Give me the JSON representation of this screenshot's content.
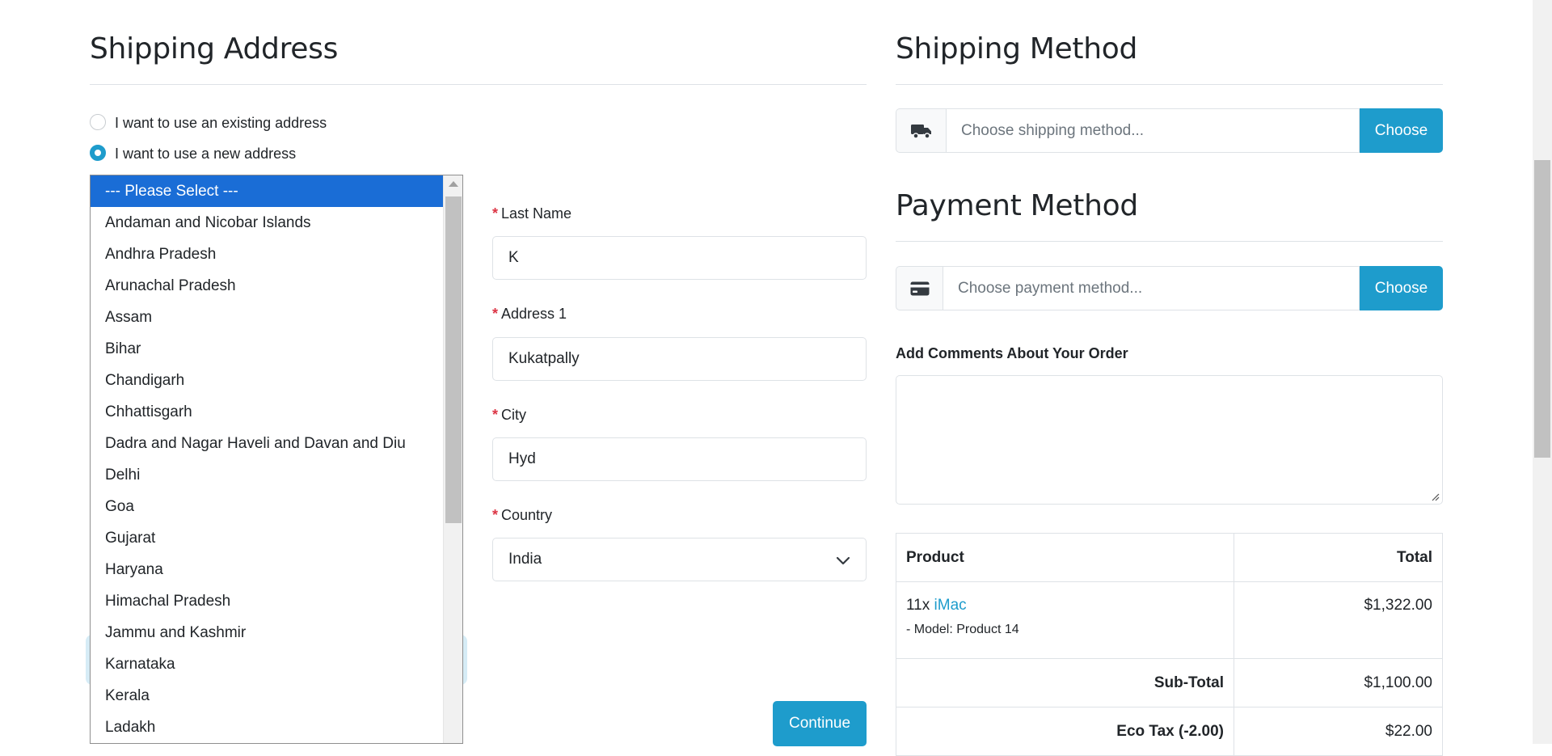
{
  "shipping_address": {
    "title": "Shipping Address",
    "radio_existing": "I want to use an existing address",
    "radio_new": "I want to use a new address"
  },
  "zone_dropdown": {
    "options": [
      "--- Please Select ---",
      "Andaman and Nicobar Islands",
      "Andhra Pradesh",
      "Arunachal Pradesh",
      "Assam",
      "Bihar",
      "Chandigarh",
      "Chhattisgarh",
      "Dadra and Nagar Haveli and Davan and Diu",
      "Delhi",
      "Goa",
      "Gujarat",
      "Haryana",
      "Himachal Pradesh",
      "Jammu and Kashmir",
      "Karnataka",
      "Kerala",
      "Ladakh"
    ],
    "selected": "--- Please Select ---"
  },
  "form": {
    "last_name_label": "Last Name",
    "last_name_value": "K",
    "address1_label": "Address 1",
    "address1_value": "Kukatpally",
    "city_label": "City",
    "city_value": "Hyd",
    "country_label": "Country",
    "country_value": "India",
    "required_mark": "*",
    "continue_label": "Continue"
  },
  "shipping_method": {
    "title": "Shipping Method",
    "placeholder": "Choose shipping method...",
    "button": "Choose",
    "icon": "truck-icon"
  },
  "payment_method": {
    "title": "Payment Method",
    "placeholder": "Choose payment method...",
    "button": "Choose",
    "icon": "credit-card-icon"
  },
  "comments": {
    "label": "Add Comments About Your Order"
  },
  "cart": {
    "header_product": "Product",
    "header_total": "Total",
    "item_qty": "11x",
    "item_name": "iMac",
    "item_model": "- Model: Product 14",
    "item_total": "$1,322.00",
    "subtotal_label": "Sub-Total",
    "subtotal_value": "$1,100.00",
    "ecotax_label": "Eco Tax (-2.00)",
    "ecotax_value": "$22.00"
  },
  "colors": {
    "accent": "#1e9ccc",
    "selected_option": "#1a6dd6",
    "required": "#dc3545"
  }
}
